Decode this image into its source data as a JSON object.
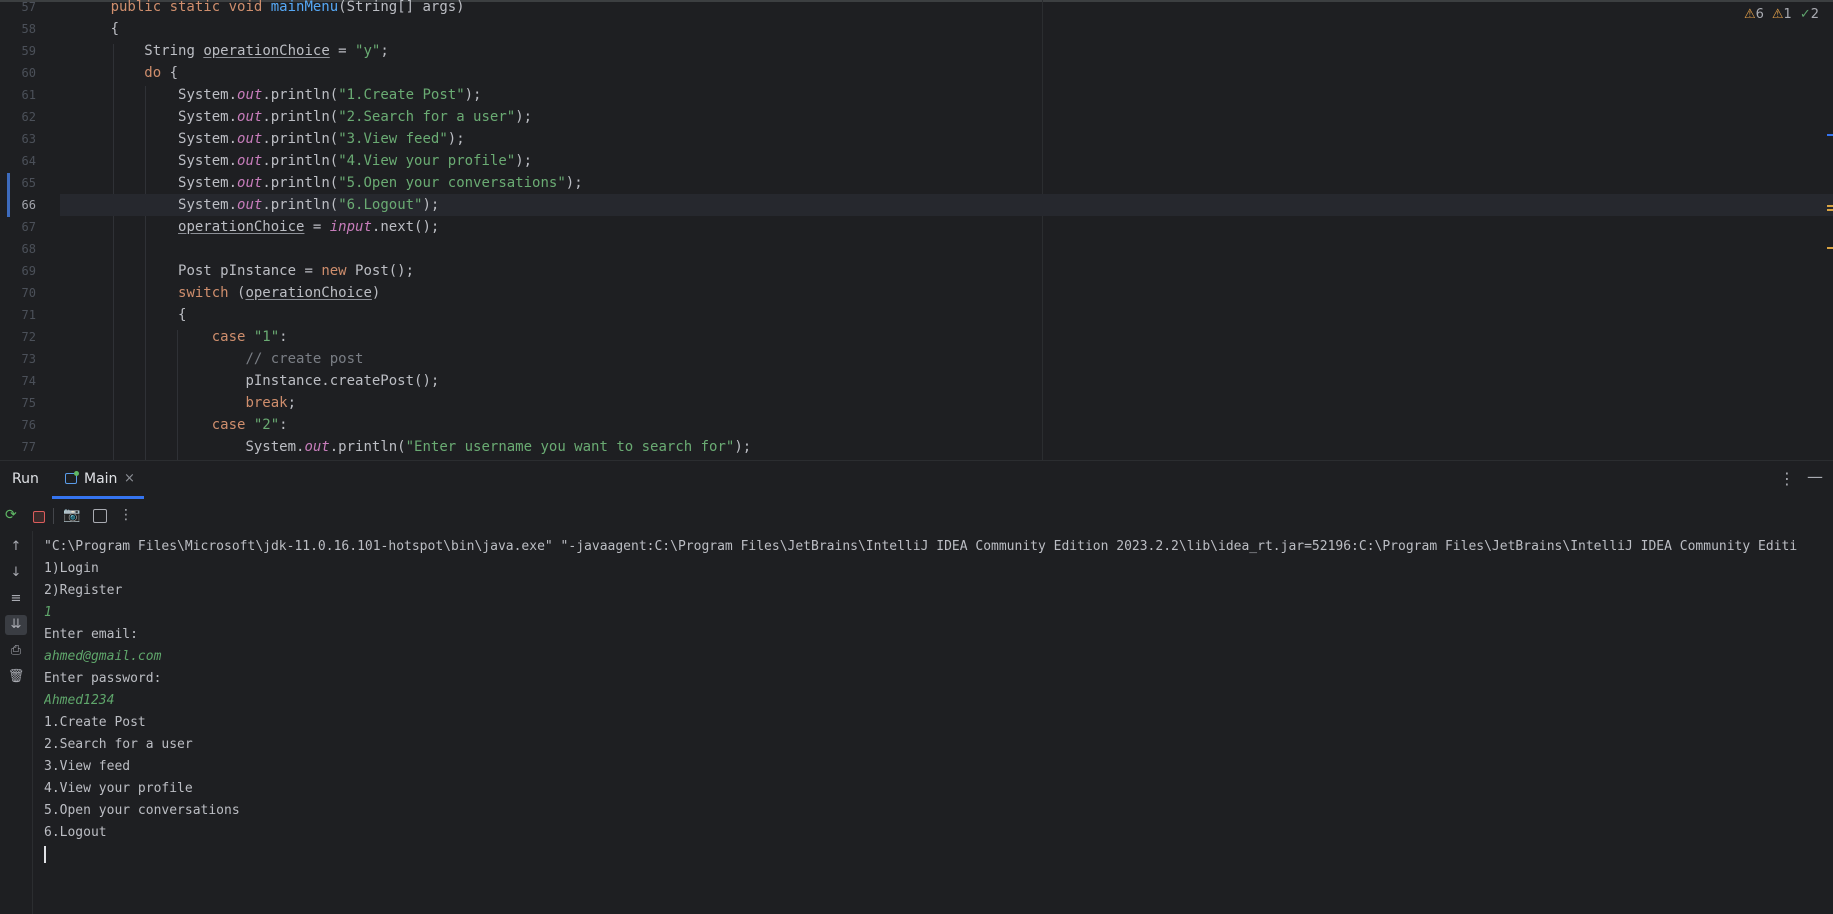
{
  "editor": {
    "line_numbers": [
      "57",
      "58",
      "59",
      "60",
      "61",
      "62",
      "63",
      "64",
      "65",
      "66",
      "67",
      "68",
      "69",
      "70",
      "71",
      "72",
      "73",
      "74",
      "75",
      "76",
      "77"
    ],
    "current_line": "66",
    "inspections": {
      "warnings": "6",
      "weak_warnings": "1",
      "typos": "2"
    },
    "code": {
      "l57": {
        "kw1": "public static void ",
        "fn": "mainMenu",
        "rest": "(String[] args)"
      },
      "l58": "{",
      "l59": {
        "type": "String ",
        "var": "operationChoice",
        "eq": " = ",
        "str": "\"y\"",
        "end": ";"
      },
      "l60": {
        "kw": "do",
        "rest": " {"
      },
      "println_prefix": "System.",
      "println_out": "out",
      "println_call": ".println(",
      "println_end": ");",
      "l61": "\"1.Create Post\"",
      "l62": "\"2.Search for a user\"",
      "l63": "\"3.View feed\"",
      "l64": "\"4.View your profile\"",
      "l65": "\"5.Open your conversations\"",
      "l66": "\"6.Logout\"",
      "l67": {
        "var": "operationChoice",
        "eq": " = ",
        "input": "input",
        "rest": ".next();"
      },
      "l69": {
        "a": "Post pInstance = ",
        "kw": "new",
        "b": " Post();"
      },
      "l70": {
        "kw": "switch",
        "a": " (",
        "var": "operationChoice",
        "b": ")"
      },
      "l71": "{",
      "l72": {
        "kw": "case ",
        "str": "\"1\"",
        "end": ":"
      },
      "l73": "// create post",
      "l74": "pInstance.createPost();",
      "l75": {
        "kw": "break",
        "end": ";"
      },
      "l76": {
        "kw": "case ",
        "str": "\"2\"",
        "end": ":"
      },
      "l77": "\"Enter username you want to search for\""
    }
  },
  "run_panel": {
    "title": "Run",
    "tab_label": "Main",
    "close_glyph": "×",
    "menu_glyph": "⋮",
    "minimize_glyph": "—",
    "console_lines": [
      {
        "text": "\"C:\\Program Files\\Microsoft\\jdk-11.0.16.101-hotspot\\bin\\java.exe\" \"-javaagent:C:\\Program Files\\JetBrains\\IntelliJ IDEA Community Edition 2023.2.2\\lib\\idea_rt.jar=52196:C:\\Program Files\\JetBrains\\IntelliJ IDEA Community Editi",
        "input": false
      },
      {
        "text": "1)Login",
        "input": false
      },
      {
        "text": "2)Register",
        "input": false
      },
      {
        "text": "1",
        "input": true
      },
      {
        "text": "Enter email:",
        "input": false
      },
      {
        "text": "ahmed@gmail.com",
        "input": true
      },
      {
        "text": "Enter password:",
        "input": false
      },
      {
        "text": "Ahmed1234",
        "input": true
      },
      {
        "text": "1.Create Post",
        "input": false
      },
      {
        "text": "2.Search for a user",
        "input": false
      },
      {
        "text": "3.View feed",
        "input": false
      },
      {
        "text": "4.View your profile",
        "input": false
      },
      {
        "text": "5.Open your conversations",
        "input": false
      },
      {
        "text": "6.Logout",
        "input": false
      }
    ]
  },
  "icons": {
    "rerun": "rerun-icon",
    "stop": "stop-icon",
    "screenshot": "camera-icon",
    "restore-layout": "restore-layout-icon",
    "more": "more-icon",
    "scroll-up": "arrow-up-icon",
    "scroll-down": "arrow-down-icon",
    "soft-wrap": "soft-wrap-icon",
    "scroll-to-end": "scroll-to-end-icon",
    "print": "print-icon",
    "clear": "trash-icon"
  },
  "colors": {
    "background": "#1e1f22",
    "keyword": "#cf8e6d",
    "string": "#6aab73",
    "function": "#56a8f5",
    "static_field": "#c77dbb",
    "user_input": "#5fa66b",
    "accent": "#3574f0"
  }
}
